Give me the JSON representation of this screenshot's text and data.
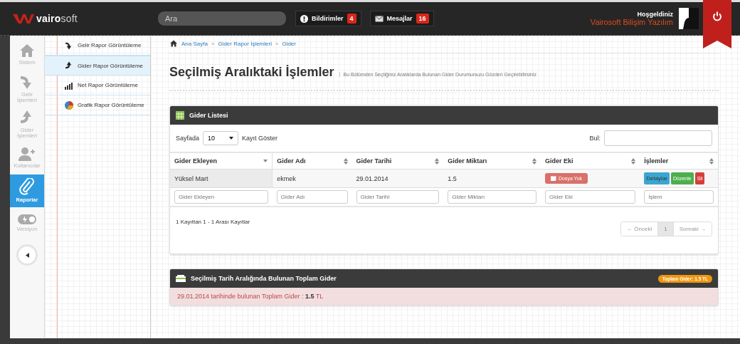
{
  "topbar": {
    "logo": {
      "part_1": "vairo",
      "part_2": "soft"
    },
    "search": {
      "placeholder": "Ara"
    },
    "notifications": [
      {
        "kind": "alert",
        "label": "Bildirimler",
        "count": "4"
      },
      {
        "kind": "mail",
        "label": "Mesajlar",
        "count": "16"
      }
    ],
    "user": {
      "greeting": "Hoşgeldiniz",
      "name": "Vairosoft Bilişim Yazılım"
    }
  },
  "sidebar": {
    "items": [
      {
        "kind": "home",
        "label": "Sistem",
        "selected": false
      },
      {
        "kind": "income",
        "label": "Gelir İşlemleri",
        "selected": false
      },
      {
        "kind": "expense",
        "label": "Gider İşlemleri",
        "selected": false
      },
      {
        "kind": "users",
        "label": "Kullanıcılar",
        "selected": false
      },
      {
        "kind": "reports",
        "label": "Raporlar",
        "selected": true
      },
      {
        "kind": "version",
        "label": "Versiyon",
        "selected": false
      }
    ]
  },
  "submenu": {
    "items": [
      {
        "kind": "income",
        "label": "Gelir Rapor Görüntüleme",
        "selected": false
      },
      {
        "kind": "expense",
        "label": "Gider Rapor Görüntüleme",
        "selected": true
      },
      {
        "kind": "net",
        "label": "Net Rapor Görüntüleme",
        "selected": false
      },
      {
        "kind": "graph",
        "label": "Grafik Rapor Görüntüleme",
        "selected": false
      }
    ]
  },
  "breadcrumb": {
    "separator": "»",
    "items": [
      "Ana Sayfa",
      "Gider Rapor İşlemleri",
      "Gider"
    ]
  },
  "page_header": {
    "title": "Seçilmiş Aralıktaki İşlemler",
    "subtitle": "Bu Bölümden Seçtiğiniz Aralıklarda Bulunan Gider Durumunuzu Gözden Geçirebilirsiniz"
  },
  "list_panel": {
    "title": "Gider Listesi",
    "length_label": "Sayfada",
    "length_value": "10",
    "length_suffix": "Kayıt Göster",
    "search_label": "Bul:",
    "columns": [
      {
        "label": "Gider Ekleyen",
        "sorted": true
      },
      {
        "label": "Gider Adı",
        "sorted": false
      },
      {
        "label": "Gider Tarihi",
        "sorted": false
      },
      {
        "label": "Gider Miktarı",
        "sorted": false
      },
      {
        "label": "Gider Eki",
        "sorted": false
      },
      {
        "label": "İşlemler",
        "sorted": false
      }
    ],
    "rows": [
      {
        "added_by": "Yüksel Mart",
        "name": "ekmek",
        "date": "29.01.2014",
        "amount": "1.5",
        "attachment": "Dosya Yok",
        "actions": [
          {
            "kind": "info",
            "label": "Detaylar"
          },
          {
            "kind": "edit",
            "label": "Düzenle"
          },
          {
            "kind": "delete",
            "label": "Sil"
          }
        ]
      }
    ],
    "filters": [
      {
        "placeholder": "Gider Ekleyen"
      },
      {
        "placeholder": "Gider Adı"
      },
      {
        "placeholder": "Gider Tarihi"
      },
      {
        "placeholder": "Gider Miktarı"
      },
      {
        "placeholder": "Gider Eki"
      },
      {
        "placeholder": "İşlem"
      }
    ],
    "info": "1 Kayıttan 1 - 1 Arası Kayıtlar",
    "pagination": [
      {
        "label": "← Önceki",
        "selected": false,
        "disabled": true
      },
      {
        "label": "1",
        "selected": true,
        "disabled": false
      },
      {
        "label": "Sonraki →",
        "selected": false,
        "disabled": true
      }
    ]
  },
  "total_panel": {
    "title": "Seçilmiş Tarih Aralığında Bulunan Toplam Gider",
    "badge": "Toplam Gider: 1.5 TL",
    "message": "29.01.2014 tarihinde bulunan Toplam Gider : **1.5** TL"
  }
}
